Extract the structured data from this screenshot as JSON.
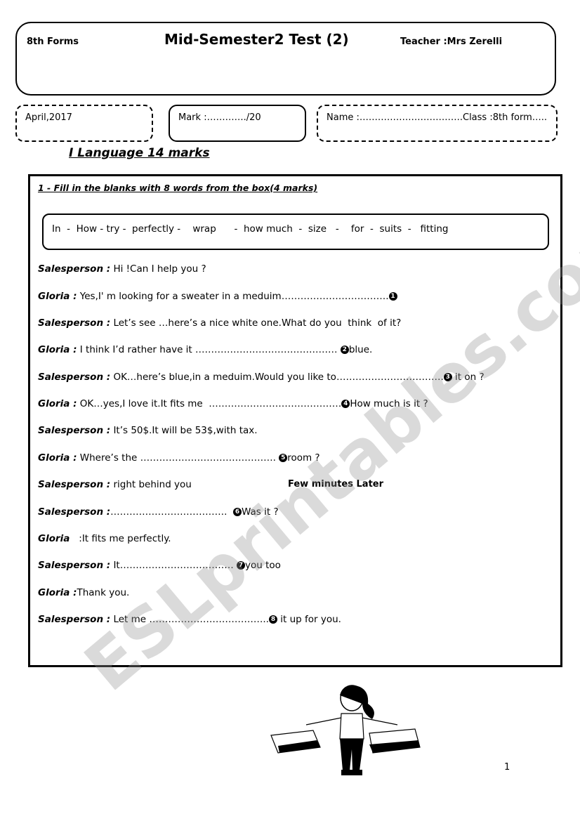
{
  "header": {
    "forms": "8th Forms",
    "title": "Mid-Semester2 Test (2)",
    "teacher": "Teacher :Mrs Zerelli"
  },
  "info": {
    "date": "April,2017",
    "mark": "Mark :…………./20",
    "name": "Name :…………………………….Class :8th form….."
  },
  "section": {
    "title": "I Language 14 marks"
  },
  "question1": {
    "title": "1 - Fill in the blanks with 8 words from the box(4 marks)",
    "word_box": "In  -  How - try -  perfectly -    wrap      -  how much  -  size   -    for  -  suits  -   fitting",
    "lines": [
      {
        "speaker": "Salesperson :",
        "before": " Hi !Can I help you ?",
        "num": "",
        "after": ""
      },
      {
        "speaker": "Gloria :",
        "before": " Yes,I' m looking for a sweater in a meduim…………………………….",
        "num": "1",
        "after": ""
      },
      {
        "speaker": "Salesperson :",
        "before": " Let’s see …here’s a nice white one.What do you  think  of it?",
        "num": "",
        "after": ""
      },
      {
        "speaker": "Gloria :",
        "before": " I think I’d rather have it ……………………………………… ",
        "num": "2",
        "after": "blue."
      },
      {
        "speaker": "Salesperson :",
        "before": " OK…here’s blue,in a meduim.Would you like to…………………………….",
        "num": "3",
        "after": " it on ?"
      },
      {
        "speaker": "Gloria :",
        "before": " OK…yes,I love it.It fits me  ……………………………………",
        "num": "4",
        "after": "How much is it ?"
      },
      {
        "speaker": "Salesperson :",
        "before": " It’s 50$.It will be 53$,with tax.",
        "num": "",
        "after": ""
      },
      {
        "speaker": "Gloria :",
        "before": " Where’s the ……………………………………. ",
        "num": "5",
        "after": "room ?"
      },
      {
        "speaker": "Salesperson :",
        "before": " right behind you",
        "num": "",
        "after": ""
      },
      {
        "speaker": "Salesperson :",
        "before": "……………………………….  ",
        "num": "6",
        "after": "Was it ?"
      },
      {
        "speaker": "Gloria",
        "before": "   :It fits me perfectly.",
        "num": "",
        "after": ""
      },
      {
        "speaker": "Salesperson :",
        "before": " It……………………………… ",
        "num": "7",
        "after": "you too"
      },
      {
        "speaker": "Gloria :",
        "before": "Thank you.",
        "num": "",
        "after": ""
      },
      {
        "speaker": "Salesperson :",
        "before": " Let me ………………………………..",
        "num": "8",
        "after": " it up for you."
      }
    ],
    "stage_note": "Few minutes Later"
  },
  "watermark": "ESLprintables.com",
  "page_number": "1"
}
